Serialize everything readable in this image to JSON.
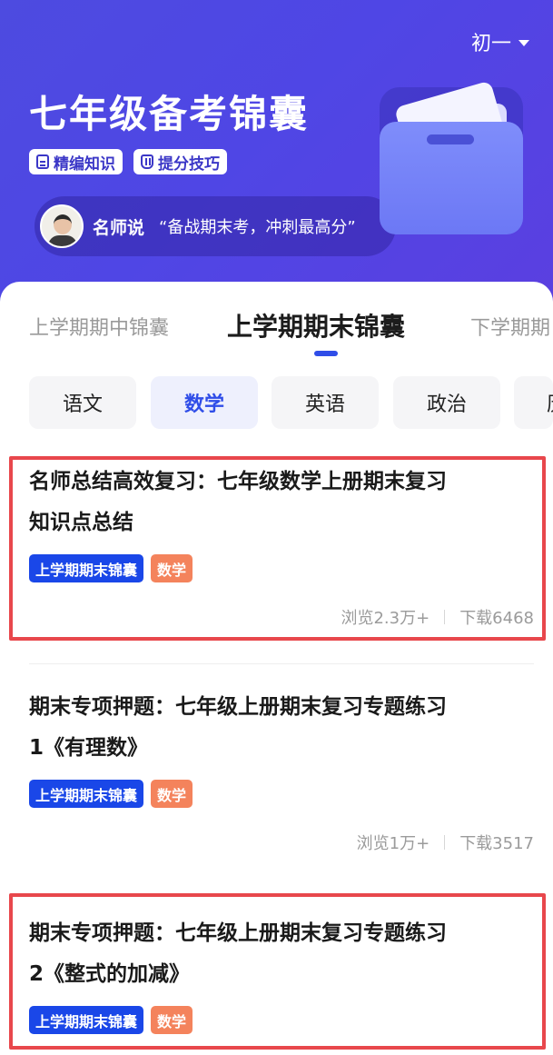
{
  "header": {
    "grade_label": "初一",
    "title": "七年级备考锦囊",
    "chips": [
      {
        "label": "精编知识",
        "icon": "document-icon"
      },
      {
        "label": "提分技巧",
        "icon": "tips-icon"
      }
    ],
    "teacher": {
      "name": "名师说",
      "quote": "“备战期末考，冲刺最高分”"
    }
  },
  "period_tabs": [
    {
      "label": "上学期期中锦囊",
      "active": false
    },
    {
      "label": "上学期期末锦囊",
      "active": true
    },
    {
      "label": "下学期期",
      "active": false
    }
  ],
  "subjects": [
    {
      "label": "语文",
      "active": false
    },
    {
      "label": "数学",
      "active": true
    },
    {
      "label": "英语",
      "active": false
    },
    {
      "label": "政治",
      "active": false
    },
    {
      "label": "历",
      "active": false
    }
  ],
  "cards": [
    {
      "title_line1": "名师总结高效复习：七年级数学上册期末复习",
      "title_line2": "知识点总结",
      "tag_period": "上学期期末锦囊",
      "tag_subject": "数学",
      "views": "浏览2.3万+",
      "downloads": "下载6468",
      "highlighted": true
    },
    {
      "title_line1": "期末专项押题：七年级上册期末复习专题练习",
      "title_line2": "1《有理数》",
      "tag_period": "上学期期末锦囊",
      "tag_subject": "数学",
      "views": "浏览1万+",
      "downloads": "下载3517",
      "highlighted": false
    },
    {
      "title_line1": "期末专项押题：七年级上册期末复习专题练习",
      "title_line2": "2《整式的加减》",
      "tag_period": "上学期期末锦囊",
      "tag_subject": "数学",
      "highlighted": true
    }
  ],
  "colors": {
    "hero": "#4f46e5",
    "accent": "#2f4de8",
    "tag_blue": "#1a47e8",
    "tag_orange": "#f4835c",
    "highlight_red": "#e8474c"
  }
}
